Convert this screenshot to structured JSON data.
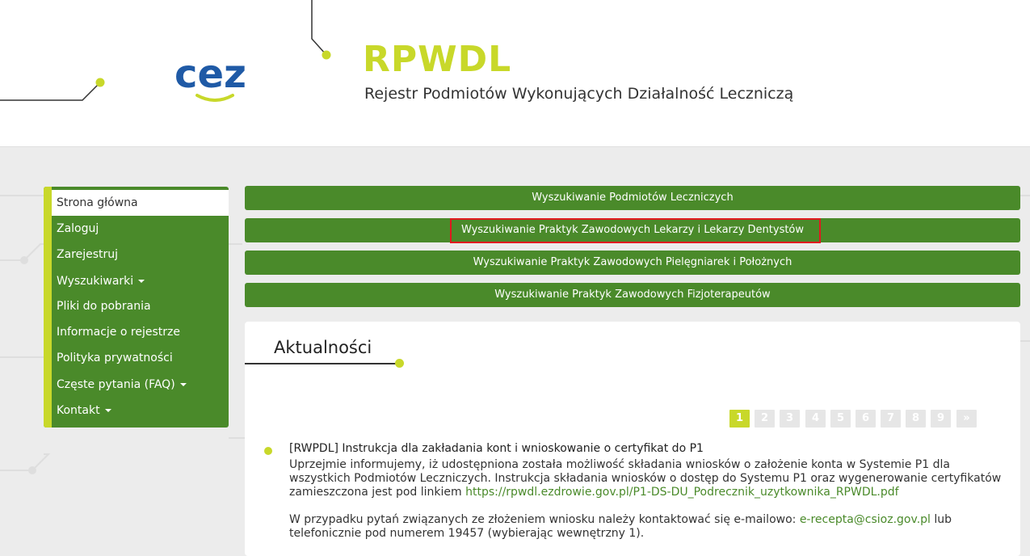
{
  "header": {
    "logo_text": "cez",
    "brand_title": "RPWDL",
    "brand_subtitle": "Rejestr Podmiotów Wykonujących Działalność Leczniczą"
  },
  "sidebar": {
    "items": [
      {
        "label": "Strona główna",
        "active": true
      },
      {
        "label": "Zaloguj"
      },
      {
        "label": "Zarejestruj"
      },
      {
        "label": "Wyszukiwarki",
        "dropdown": true
      },
      {
        "label": "Pliki do pobrania"
      },
      {
        "label": "Informacje o rejestrze"
      },
      {
        "label": "Polityka prywatności"
      },
      {
        "label": "Częste pytania (FAQ)",
        "dropdown": true
      },
      {
        "label": "Kontakt",
        "dropdown": true
      }
    ]
  },
  "search_buttons": [
    {
      "label": "Wyszukiwanie Podmiotów Leczniczych"
    },
    {
      "label": "Wyszukiwanie Praktyk Zawodowych Lekarzy i Lekarzy Dentystów",
      "highlighted": true
    },
    {
      "label": "Wyszukiwanie Praktyk Zawodowych Pielęgniarek i Położnych"
    },
    {
      "label": "Wyszukiwanie Praktyk Zawodowych Fizjoterapeutów"
    }
  ],
  "news": {
    "title": "Aktualności",
    "pagination": [
      "1",
      "2",
      "3",
      "4",
      "5",
      "6",
      "7",
      "8",
      "9",
      "»"
    ],
    "current_page": "1",
    "item": {
      "title": "[RWPDL] Instrukcja dla zakładania kont i wnioskowanie o certyfikat do P1",
      "paragraph1_text": "Uprzejmie informujemy, iż udostępniona została możliwość składania wniosków o założenie konta w Systemie P1 dla wszystkich Podmiotów Leczniczych. Instrukcja składania wniosków o dostęp do Systemu P1 oraz wygenerowanie certyfikatów zamieszczona jest pod linkiem ",
      "paragraph1_link": "https://rpwdl.ezdrowie.gov.pl/P1-DS-DU_Podrecznik_uzytkownika_RPWDL.pdf",
      "paragraph2_text": "W przypadku pytań związanych ze złożeniem wniosku należy kontaktować się e-mailowo: ",
      "paragraph2_email": "e-recepta@csioz.gov.pl",
      "paragraph2_rest": " lub telefonicznie pod numerem 19457 (wybierając wewnętrzny 1)."
    }
  },
  "colors": {
    "brand_green": "#4a8a2a",
    "accent_lime": "#c8d82a",
    "highlight_red": "#e0191f"
  }
}
